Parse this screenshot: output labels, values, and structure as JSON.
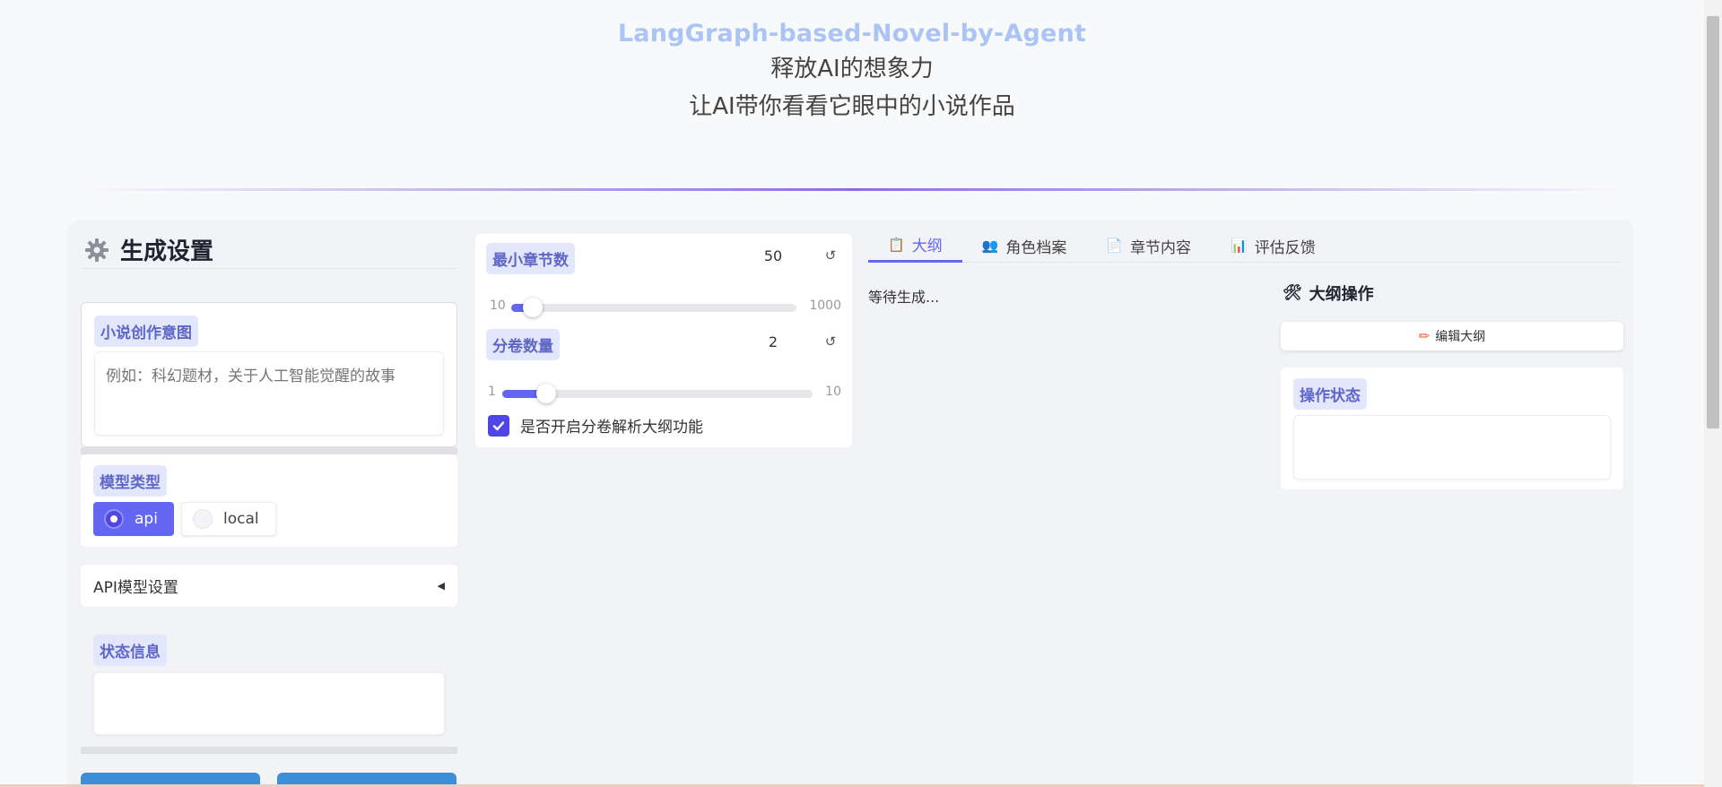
{
  "header": {
    "app_title": "LangGraph-based-Novel-by-Agent",
    "subtitle_1": "释放AI的想象力",
    "subtitle_2": "让AI带你看看它眼中的小说作品"
  },
  "settings": {
    "title": "生成设置",
    "icon": "gear-icon",
    "intent": {
      "label": "小说创作意图",
      "placeholder": "例如：科幻题材，关于人工智能觉醒的故事",
      "value": ""
    },
    "model_type": {
      "label": "模型类型",
      "options": [
        "api",
        "local"
      ],
      "selected": "api"
    },
    "api_settings": {
      "label": "API模型设置",
      "collapsed": true
    },
    "status": {
      "label": "状态信息",
      "value": ""
    }
  },
  "params": {
    "min_chapters": {
      "label": "最小章节数",
      "value": "50",
      "min": "10",
      "max": "1000",
      "fraction": 0.04
    },
    "volumes": {
      "label": "分卷数量",
      "value": "2",
      "min": "1",
      "max": "10",
      "fraction": 0.11
    },
    "volume_parse": {
      "label": "是否开启分卷解析大纲功能",
      "checked": true
    },
    "reset_symbol": "↺"
  },
  "tabs": [
    {
      "label": "大纲",
      "icon": "clipboard-icon",
      "active": true
    },
    {
      "label": "角色档案",
      "icon": "people-icon",
      "active": false
    },
    {
      "label": "章节内容",
      "icon": "document-icon",
      "active": false
    },
    {
      "label": "评估反馈",
      "icon": "chart-icon",
      "active": false
    }
  ],
  "outline": {
    "waiting_text": "等待生成...",
    "ops_title": "大纲操作",
    "ops_icon": "tools-icon",
    "edit_button": "编辑大纲",
    "op_status_label": "操作状态",
    "op_status_value": ""
  },
  "colors": {
    "accent": "#6366f1",
    "title": "#a9c4f5",
    "chip_bg": "#e3e7fb",
    "button_blue": "#3b8fd9"
  }
}
